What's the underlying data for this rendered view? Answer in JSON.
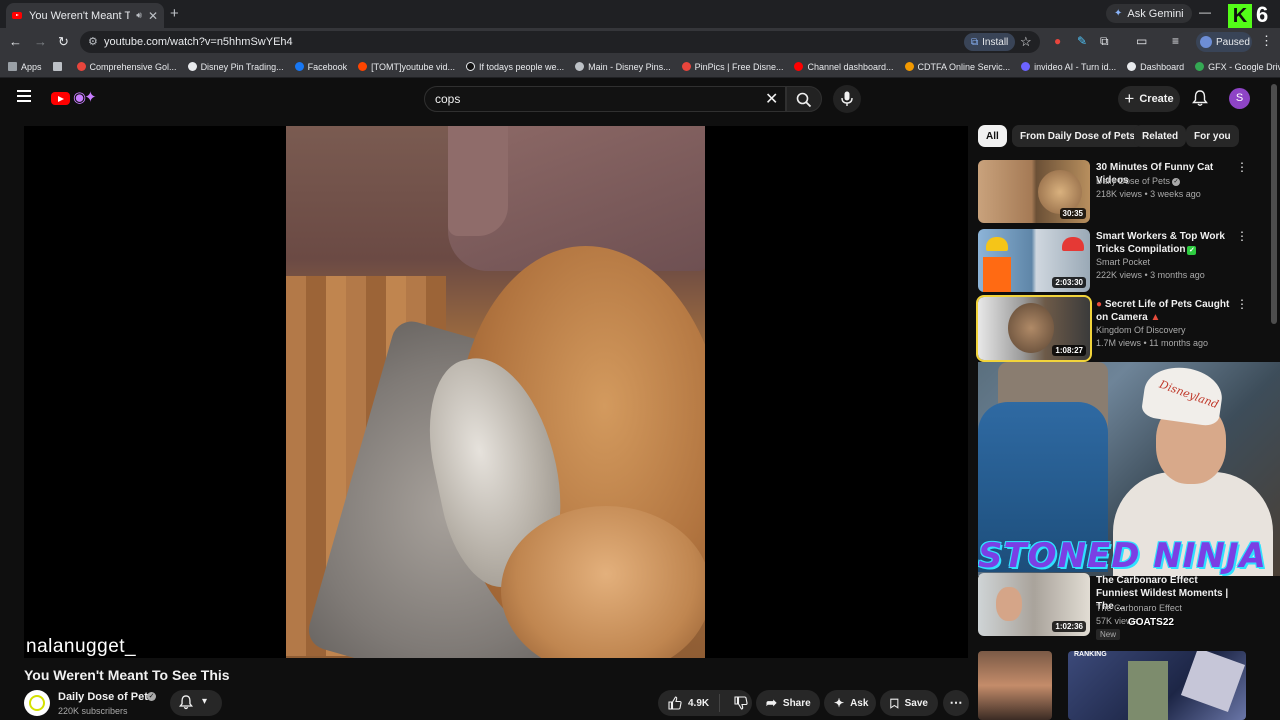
{
  "browser": {
    "tab_title": "You Weren't Meant To See",
    "new_tab_label": "+",
    "ask_gemini": "Ask Gemini",
    "url": "youtube.com/watch?v=n5hhmSwYEh4",
    "install_label": "Install",
    "profile_status": "Paused",
    "kick_badge": "K",
    "kick_count": "6"
  },
  "bookmarks": [
    {
      "label": "Apps",
      "color": "#9aa0a6"
    },
    {
      "label": "Comprehensive Gol...",
      "color": "#e8453c"
    },
    {
      "label": "Disney Pin Trading...",
      "color": "#e8eaed"
    },
    {
      "label": "Facebook",
      "color": "#1877f2"
    },
    {
      "label": "[TOMT]youtube vid...",
      "color": "#ff4500"
    },
    {
      "label": "If todays people we...",
      "color": "#111111"
    },
    {
      "label": "Main - Disney Pins...",
      "color": "#bdc1c6"
    },
    {
      "label": "PinPics | Free Disne...",
      "color": "#e8453c"
    },
    {
      "label": "Channel dashboard...",
      "color": "#ff0000"
    },
    {
      "label": "CDTFA Online Servic...",
      "color": "#f29900"
    },
    {
      "label": "invideo AI - Turn id...",
      "color": "#6c63ff"
    },
    {
      "label": "Dashboard",
      "color": "#e8eaed"
    },
    {
      "label": "GFX - Google Drive",
      "color": "#34a853"
    }
  ],
  "youtube": {
    "search_value": "cops",
    "create_label": "Create",
    "avatar_letter": "S",
    "watermark": "nalanugget_",
    "video_title": "You Weren't Meant To See This",
    "channel_name": "Daily Dose of Pets",
    "subscribers": "220K subscribers",
    "likes": "4.9K",
    "share_label": "Share",
    "ask_label": "Ask",
    "save_label": "Save",
    "more_label": "⋯"
  },
  "chips": [
    "All",
    "From Daily Dose of Pets",
    "Related",
    "For you"
  ],
  "recommendations": [
    {
      "title": "30 Minutes Of Funny Cat Videos",
      "channel": "Daily Dose of Pets",
      "meta": "218K views • 3 weeks ago",
      "duration": "30:35"
    },
    {
      "title": "Smart Workers & Top Work Tricks Compilation",
      "channel": "Smart Pocket",
      "meta": "222K views • 3 months ago",
      "duration": "2:03:30"
    },
    {
      "title": "Secret Life of Pets Caught on Camera",
      "channel": "Kingdom Of Discovery",
      "meta": "1.7M views • 11 months ago",
      "duration": "1:08:27"
    },
    {
      "title": "The Carbonaro Effect Funniest Wildest Moments | The ...",
      "channel": "The Carbonaro Effect",
      "meta": "57K views",
      "duration": "1:02:36",
      "badge": "New"
    }
  ],
  "overlay": {
    "streamer_name": "STONED NINJA",
    "hat_text": "Disneyland",
    "goats_text": "GOATS22",
    "ranking_text": "RANKING"
  },
  "colors": {
    "youtube_red": "#ff0000",
    "highlight": "#f2d43b",
    "background": "#0f0f0f"
  }
}
